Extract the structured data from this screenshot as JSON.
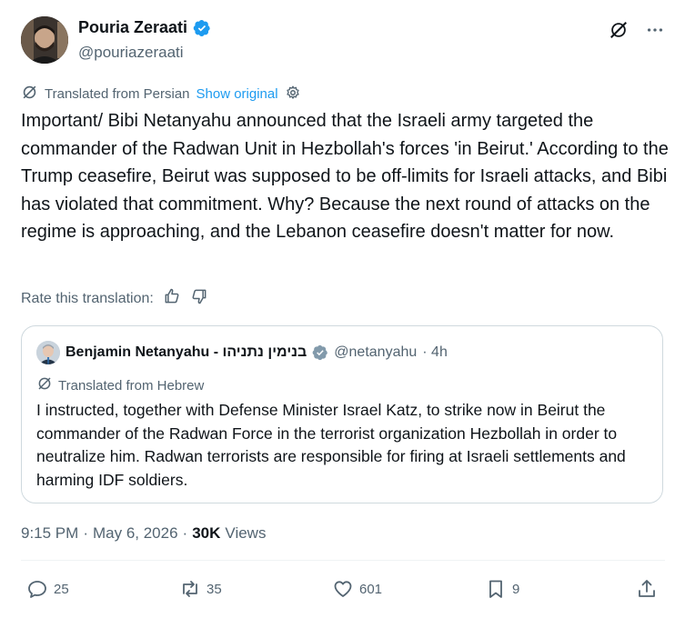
{
  "author": {
    "name": "Pouria Zeraati",
    "handle": "@pouriazeraati",
    "verified_color": "#1d9bf0"
  },
  "translation": {
    "label": "Translated from Persian",
    "show_original": "Show original"
  },
  "tweet_text": "Important/ Bibi Netanyahu announced that the Israeli army targeted the commander of the Radwan Unit in Hezbollah's forces 'in Beirut.' According to the Trump ceasefire, Beirut was supposed to be off-limits for Israeli attacks, and Bibi has violated that commitment. Why? Because the next round of attacks on the regime is approaching, and the Lebanon ceasefire doesn't matter for now.",
  "rate_translation": "Rate this translation:",
  "quote": {
    "name": "Benjamin Netanyahu - בנימין נתניהו",
    "handle": "@netanyahu",
    "time": "· 4h",
    "translation_label": "Translated from Hebrew",
    "text": "I instructed, together with Defense Minister Israel Katz, to strike now in Beirut the commander of the Radwan Force in the terrorist organization Hezbollah in order to neutralize him. Radwan terrorists are responsible for firing at Israeli settlements and harming IDF soldiers.",
    "badge_color": "#829aab"
  },
  "meta": {
    "time": "9:15 PM",
    "sep": "·",
    "date": "May 6, 2026",
    "sep2": "·",
    "views_count": "30K",
    "views_label": "Views"
  },
  "actions": {
    "replies": "25",
    "reposts": "35",
    "likes": "601",
    "bookmarks": "9"
  },
  "icons": [
    "grok-icon",
    "more-icon",
    "translate-icon",
    "settings-gear-icon",
    "thumbs-up-icon",
    "thumbs-down-icon",
    "reply-icon",
    "repost-icon",
    "like-icon",
    "bookmark-icon",
    "share-icon"
  ]
}
